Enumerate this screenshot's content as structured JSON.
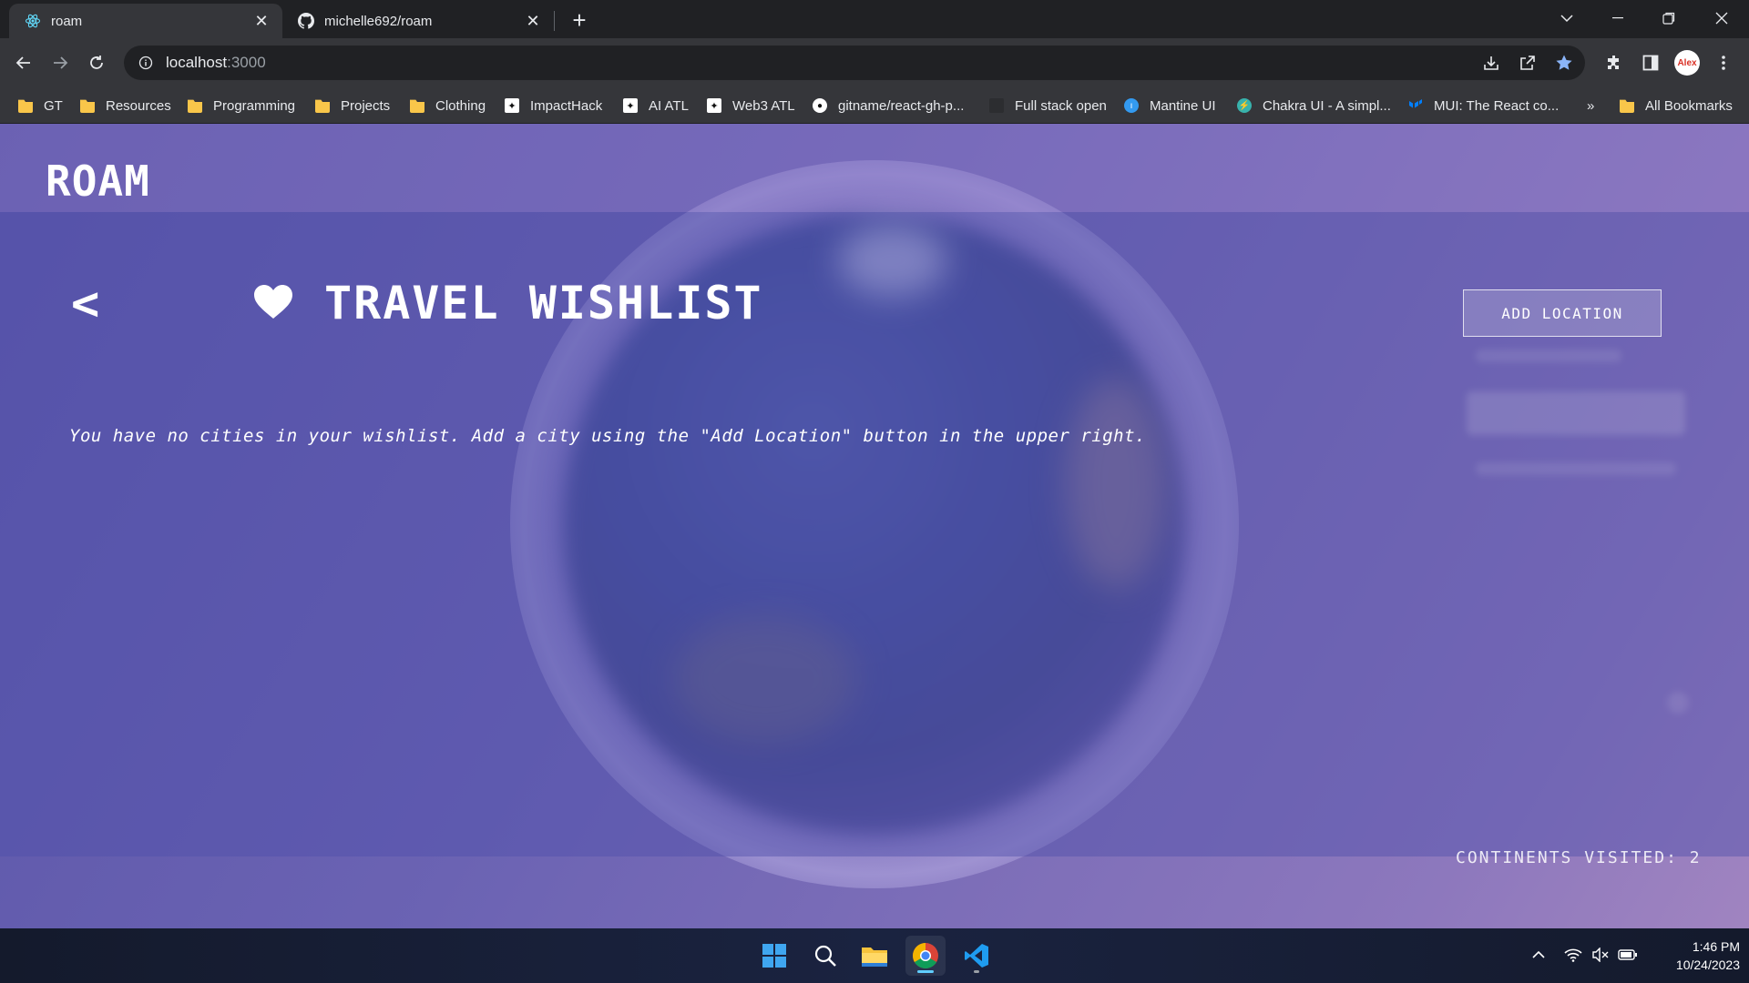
{
  "browser": {
    "tabs": [
      {
        "title": "roam",
        "active": true
      },
      {
        "title": "michelle692/roam",
        "active": false
      }
    ],
    "url": "localhost",
    "url_port": ":3000",
    "bookmarks": [
      {
        "label": "GT",
        "icon": "folder-icon"
      },
      {
        "label": "Resources",
        "icon": "folder-icon"
      },
      {
        "label": "Programming",
        "icon": "folder-icon"
      },
      {
        "label": "Projects",
        "icon": "folder-icon"
      },
      {
        "label": "Clothing",
        "icon": "folder-icon"
      },
      {
        "label": "ImpactHack",
        "icon": "sparkle-icon"
      },
      {
        "label": "AI ATL",
        "icon": "sparkle-icon"
      },
      {
        "label": "Web3 ATL",
        "icon": "sparkle-icon"
      },
      {
        "label": "gitname/react-gh-p...",
        "icon": "github-icon"
      },
      {
        "label": "Full stack open",
        "icon": "page-icon"
      },
      {
        "label": "Mantine UI",
        "icon": "mantine-icon"
      },
      {
        "label": "Chakra UI - A simpl...",
        "icon": "chakra-icon"
      },
      {
        "label": "MUI: The React co...",
        "icon": "mui-icon"
      }
    ],
    "bookmarks_overflow": "»",
    "all_bookmarks": "All Bookmarks",
    "profile_initials": "Alex"
  },
  "app": {
    "logo": "ROAM",
    "back_label": "<",
    "title": "TRAVEL WISHLIST",
    "add_button": "ADD LOCATION",
    "empty_message": "You have no cities in your wishlist. Add a city using the \"Add Location\" button in the upper right.",
    "continents_visited": "CONTINENTS VISITED: 2",
    "colors": {
      "accent": "#5a55a8",
      "text": "#ffffff"
    }
  },
  "taskbar": {
    "time": "1:46 PM",
    "date": "10/24/2023",
    "apps": [
      "windows-start-icon",
      "search-icon",
      "file-explorer-icon",
      "chrome-icon",
      "vscode-icon"
    ]
  }
}
